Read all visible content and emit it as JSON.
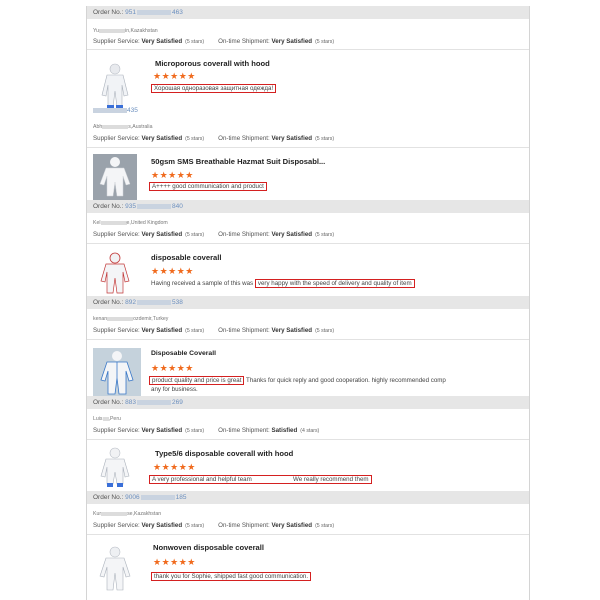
{
  "order_label": "Order No.:",
  "orders": [
    {
      "prefix": "951",
      "suffix": "463"
    },
    {
      "prefix": "",
      "suffix": "435"
    },
    {
      "prefix": "935",
      "suffix": "840"
    },
    {
      "prefix": "892",
      "suffix": "538"
    },
    {
      "prefix": "883",
      "suffix": "269"
    },
    {
      "prefix": "9006",
      "suffix": "185"
    }
  ],
  "supplier_label": "Supplier Service:",
  "shipment_label": "On-time Shipment:",
  "reviews": [
    {
      "buyer_a": "Yu",
      "buyer_b": "in,Kazakhstan",
      "service": "Very Satisfied",
      "service_stars": "(5 stars)",
      "shipment": "Very Satisfied",
      "shipment_stars": "(5 stars)",
      "title": "Microporous coverall with hood",
      "stars": "★★★★★",
      "comment_hl": "Хорошая одноразовая защитная одежда!",
      "comment_pre": "",
      "comment_post": "",
      "comment_cont": ""
    },
    {
      "buyer_a": "Abh",
      "buyer_b": "s,Australia",
      "service": "Very Satisfied",
      "service_stars": "(5 stars)",
      "shipment": "Very Satisfied",
      "shipment_stars": "(5 stars)",
      "title": "50gsm SMS Breathable Hazmat Suit Disposabl...",
      "stars": "★★★★★",
      "comment_hl": "A++++ good communication and product",
      "comment_pre": "",
      "comment_post": "",
      "comment_cont": ""
    },
    {
      "buyer_a": "Kel",
      "buyer_b": "e,United Kingdom",
      "service": "Very Satisfied",
      "service_stars": "(5 stars)",
      "shipment": "Very Satisfied",
      "shipment_stars": "(5 stars)",
      "title": "disposable coverall",
      "stars": "★★★★★",
      "comment_pre": "Having received a sample of this was ",
      "comment_hl": "very happy with the speed of delivery and quality of item",
      "comment_post": "",
      "comment_cont": ""
    },
    {
      "buyer_a": "kenan",
      "buyer_b": "ozdemir,Turkey",
      "service": "Very Satisfied",
      "service_stars": "(5 stars)",
      "shipment": "Very Satisfied",
      "shipment_stars": "(5 stars)",
      "title": "Disposable Coverall",
      "stars": "★★★★★",
      "comment_pre": "",
      "comment_hl": "product quality and price is great",
      "comment_post": " Thanks for quick reply and good cooperation. highly recommended comp",
      "comment_cont": "any for business."
    },
    {
      "buyer_a": "Luis",
      "buyer_b": ",Peru",
      "service": "Very Satisfied",
      "service_stars": "(5 stars)",
      "shipment": "Satisfied",
      "shipment_stars": "(4 stars)",
      "title": "Type5/6 disposable coverall with hood",
      "stars": "★★★★★",
      "comment_pre": "",
      "comment_hl": "A very professional and helpful team                        We really recommend them",
      "comment_post": "",
      "comment_cont": ""
    },
    {
      "buyer_a": "Kur",
      "buyer_b": "se,Kazakhstan",
      "service": "Very Satisfied",
      "service_stars": "(5 stars)",
      "shipment": "Very Satisfied",
      "shipment_stars": "(5 stars)",
      "title": "Nonwoven disposable coverall",
      "stars": "★★★★★",
      "comment_pre": "",
      "comment_hl": "thank you for Sophie, shipped fast good communication.",
      "comment_post": "",
      "comment_cont": ""
    }
  ],
  "colors": {
    "star": "#f06a1d",
    "highlight_border": "#d42020",
    "order_bar": "#e6e6e6",
    "link": "#6b8fbf"
  },
  "icons": [
    "coverall-suit-image"
  ]
}
